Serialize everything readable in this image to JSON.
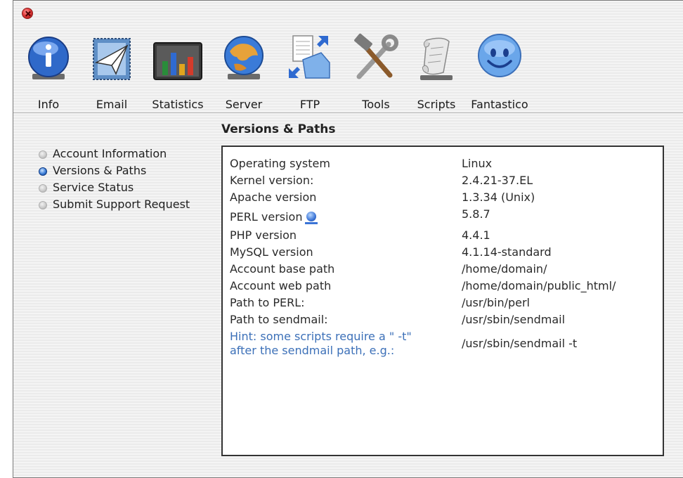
{
  "window": {
    "title": "",
    "colors": {
      "hint": "#3c70b8",
      "panel_border": "#333333",
      "close": "#e23a3a"
    }
  },
  "toolbar": {
    "items": [
      {
        "label": "Info",
        "icon": "info-icon"
      },
      {
        "label": "Email",
        "icon": "email-icon"
      },
      {
        "label": "Statistics",
        "icon": "statistics-icon"
      },
      {
        "label": "Server",
        "icon": "server-icon"
      },
      {
        "label": "FTP",
        "icon": "ftp-icon"
      },
      {
        "label": "Tools",
        "icon": "tools-icon"
      },
      {
        "label": "Scripts",
        "icon": "scripts-icon"
      },
      {
        "label": "Fantastico",
        "icon": "fantastico-icon"
      }
    ]
  },
  "section": {
    "title": "Versions & Paths"
  },
  "nav": {
    "items": [
      {
        "label": "Account Information",
        "active": false
      },
      {
        "label": "Versions & Paths",
        "active": true
      },
      {
        "label": "Service Status",
        "active": false
      },
      {
        "label": "Submit Support Request",
        "active": false
      }
    ]
  },
  "details": {
    "rows": [
      {
        "key": "Operating system",
        "value": "Linux"
      },
      {
        "key": "Kernel version:",
        "value": "2.4.21-37.EL"
      },
      {
        "key": "Apache version",
        "value": "1.3.34 (Unix)"
      },
      {
        "key": "PERL version",
        "value": "5.8.7"
      },
      {
        "key": "PHP version",
        "value": "4.4.1"
      },
      {
        "key": "MySQL version",
        "value": "4.1.14-standard"
      },
      {
        "key": "Account base path",
        "value": "/home/domain/"
      },
      {
        "key": "Account web path",
        "value": "/home/domain/public_html/"
      },
      {
        "key": "Path to PERL:",
        "value": "/usr/bin/perl"
      },
      {
        "key": "Path to sendmail:",
        "value": "/usr/sbin/sendmail"
      }
    ],
    "hint": {
      "line1": "Hint: some scripts require a \" -t\"",
      "line2": "after the sendmail path, e.g.:",
      "value": "/usr/sbin/sendmail -t"
    }
  }
}
